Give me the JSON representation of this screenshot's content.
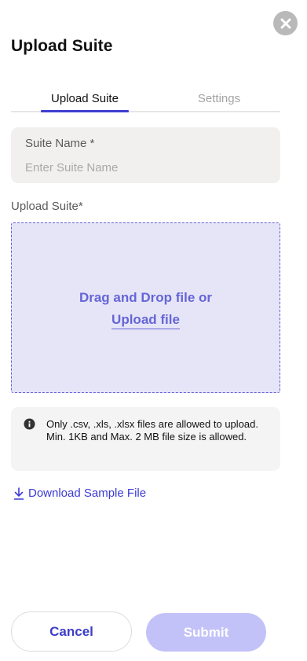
{
  "header": {
    "title": "Upload Suite",
    "close_icon": "close-icon"
  },
  "tabs": [
    {
      "label": "Upload Suite",
      "active": true
    },
    {
      "label": "Settings",
      "active": false
    }
  ],
  "suite_name": {
    "label": "Suite Name *",
    "placeholder": "Enter Suite Name",
    "value": ""
  },
  "upload": {
    "label": "Upload Suite*",
    "drop_text": "Drag and Drop file or",
    "link_text": "Upload file"
  },
  "info": {
    "icon": "info-icon",
    "line1": "Only .csv, .xls, .xlsx files are allowed to upload.",
    "line2": "Min. 1KB and Max. 2 MB file size is allowed."
  },
  "download": {
    "icon": "download-icon",
    "label": "Download Sample File"
  },
  "footer": {
    "cancel_label": "Cancel",
    "submit_label": "Submit"
  },
  "colors": {
    "accent": "#3f3fcf",
    "dropzone_bg": "#e6e5f8",
    "submit_disabled": "#c3c2f8"
  }
}
